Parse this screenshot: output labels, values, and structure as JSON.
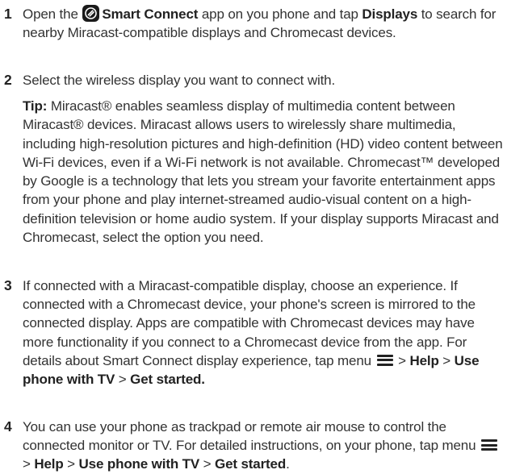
{
  "steps": [
    {
      "number": "1",
      "parts": {
        "p1": "Open the ",
        "app_name": "Smart Connect",
        "p2": " app on you phone and tap ",
        "displays": "Displays",
        "p3": " to search for nearby Miracast-compatible displays and Chromecast devices."
      }
    },
    {
      "number": "2",
      "text": "Select the wireless display you want to connect with.",
      "tip_label": "Tip:",
      "tip_text": " Miracast® enables seamless display of multimedia content between Miracast® devices. Miracast allows users to wirelessly share multimedia, including high-resolution pictures and high-definition (HD) video content between Wi-Fi devices, even if a Wi-Fi network is not available. Chromecast™ developed by Google is a technology that lets you stream your favorite entertainment apps from your phone and play internet-streamed audio-visual content on a high-definition television or home audio system. If your display supports Miracast and Chromecast, select the option you need."
    },
    {
      "number": "3",
      "parts": {
        "p1": "If connected with a Miracast-compatible display, choose an experience. If connected with a Chromecast device, your phone's screen is mirrored to the connected display. Apps are compatible with Chromecast devices may have more functionality if you connect to a Chromecast device from the app. For details about Smart Connect display experience, tap menu ",
        "sep1": " > ",
        "help": "Help",
        "sep2": " > ",
        "use_phone": "Use phone with TV",
        "sep3": " > ",
        "get_started": "Get started."
      }
    },
    {
      "number": "4",
      "parts": {
        "p1": "You can use your phone as trackpad or remote air mouse to control the connected monitor or TV. For detailed instructions, on your phone, tap menu ",
        "sep1": " > ",
        "help": "Help",
        "sep2": " > ",
        "use_phone": "Use phone with TV",
        "sep3": " > ",
        "get_started": "Get started",
        "end": "."
      }
    }
  ],
  "icons": {
    "app": "smart-connect-app-icon",
    "menu": "hamburger-menu-icon"
  }
}
